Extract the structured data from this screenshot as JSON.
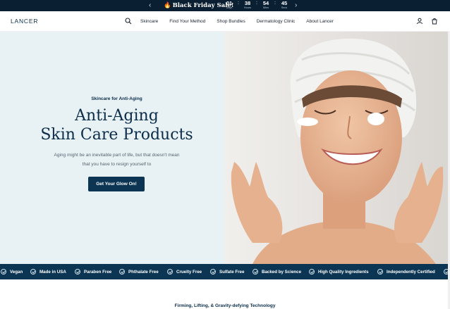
{
  "announcement": {
    "promo_text": "Black Friday Sale!",
    "countdown": [
      {
        "value": "01",
        "label": "Days"
      },
      {
        "value": "38",
        "label": "Hours"
      },
      {
        "value": "54",
        "label": "Mins"
      },
      {
        "value": "45",
        "label": "Secs"
      }
    ],
    "separator": ":"
  },
  "header": {
    "logo": "LANCER",
    "nav": [
      "Skincare",
      "Find Your Method",
      "Shop Bundles",
      "Dermatology Clinic",
      "About Lancer"
    ]
  },
  "hero": {
    "eyebrow": "Skincare for Anti-Aging",
    "title_line1": "Anti-Aging",
    "title_line2": "Skin Care Products",
    "subtitle_line1": "Aging might be an inevitable part of life, but that doesn't mean",
    "subtitle_line2": "that you have to resign yourself to",
    "cta": "Get Your Glow On!"
  },
  "features": [
    "Vegan",
    "Made in USA",
    "Paraben Free",
    "Phthalate Free",
    "Cruelty Free",
    "Sulfate Free",
    "Backed by Science",
    "High Quality Ingredients",
    "Independently Certified"
  ],
  "section": {
    "title": "Firming, Lifting, & Gravity-defying Technology"
  },
  "colors": {
    "navy": "#0b3552",
    "dark": "#0b1f33",
    "hero_bg": "#e8f2f4"
  }
}
